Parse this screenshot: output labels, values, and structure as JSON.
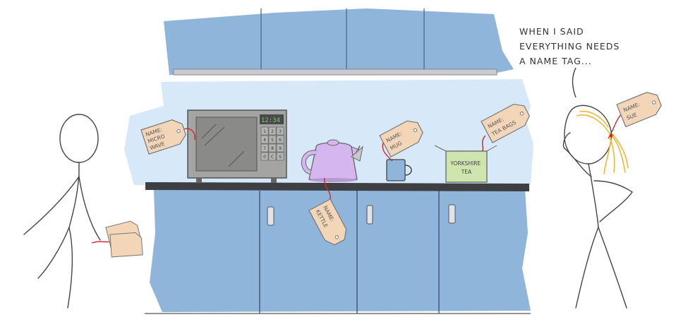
{
  "caption": {
    "lines": [
      "WHEN I SAID",
      "EVERYTHING NEEDS",
      "A NAME TAG..."
    ]
  },
  "tags": {
    "microwave": [
      "NAME:",
      "MICRO",
      "WAVE"
    ],
    "kettle": [
      "NAME:",
      "KETTLE"
    ],
    "mug": [
      "NAME:",
      "MUG"
    ],
    "tea_bags": [
      "NAME:",
      "TEA BAGS"
    ],
    "sue": [
      "NAME:",
      "SUE"
    ]
  },
  "microwave_display": "12:34",
  "microwave_keypad": [
    "1",
    "2",
    "3",
    "4",
    "5",
    "6",
    "7",
    "8",
    "9",
    "0",
    "C",
    "S"
  ],
  "tea_box_label": [
    "YORKSHIRE",
    "TEA"
  ],
  "colors": {
    "cabinet_blue": "#8fb5da",
    "wall_blue": "#d7e9f8",
    "countertop": "#3d3f42",
    "kettle_purple": "#d5b6ee",
    "tea_box_green": "#cfe5b0",
    "tag_tan": "#f3d6b8",
    "string_red": "#d4262b",
    "hair_yellow": "#f3b22a"
  }
}
